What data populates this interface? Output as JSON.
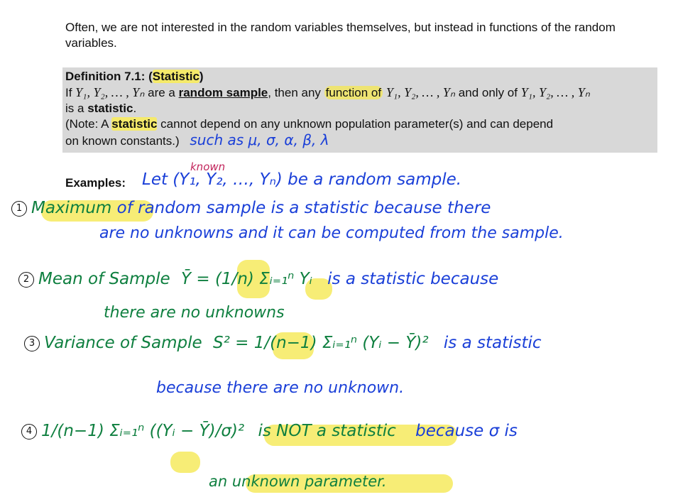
{
  "intro": "Often, we are not interested in the random variables themselves, but instead in functions of the random variables.",
  "definition": {
    "title_prefix": "Definition 7.1: (",
    "title_term": "Statistic",
    "title_suffix": ")",
    "line1_a": "If ",
    "vars": "Y₁, Y₂, … , Yₙ",
    "line1_b": " are a ",
    "random_sample": "random sample",
    "line1_c": ", then any ",
    "function_of": "function of",
    "line1_d": " and only of ",
    "line2_a": "is a ",
    "statistic": "statistic",
    "line2_b": ".",
    "note_a": "(Note: A ",
    "note_term": "statistic",
    "note_b": " cannot depend on any unknown population parameter(s) and can depend",
    "note_c": "on known constants.)",
    "handwritten_such_as": "such as  μ, σ, α, β, λ"
  },
  "examples": {
    "label": "Examples:",
    "known": "known",
    "let_text": "Let (Y₁, Y₂, …, Yₙ) be a random sample.",
    "item1_number": "1",
    "item1_term": "Maximum",
    "item1_text": "of random sample is a statistic because there",
    "item1_text2": "are no unknowns and it can be computed from the sample.",
    "item2_number": "2",
    "item2_text": "Mean of Sample",
    "item2_formula": "Ȳ = (1/n) Σᵢ₌₁ⁿ Yᵢ",
    "item2_tail": "is a statistic because",
    "item2_tail2": "there are no unknowns",
    "item3_number": "3",
    "item3_text": "Variance of Sample",
    "item3_formula": "S² = 1/(n−1) Σᵢ₌₁ⁿ (Yᵢ − Ȳ)²",
    "item3_tail": "is a statistic",
    "item3_tail2": "because there are no unknown.",
    "item4_number": "4",
    "item4_formula": "1/(n−1) Σᵢ₌₁ⁿ ((Yᵢ − Ȳ)/σ)²",
    "item4_tail_a": "is NOT a statistic",
    "item4_tail_b": "because σ is",
    "item4_tail2": "an unknown parameter."
  },
  "colors": {
    "highlight": "#f5ea6a",
    "ink_blue": "#1a3fd8",
    "ink_green": "#0e7f3f",
    "ink_pink": "#c2255c",
    "box_gray": "#d8d8d8"
  }
}
